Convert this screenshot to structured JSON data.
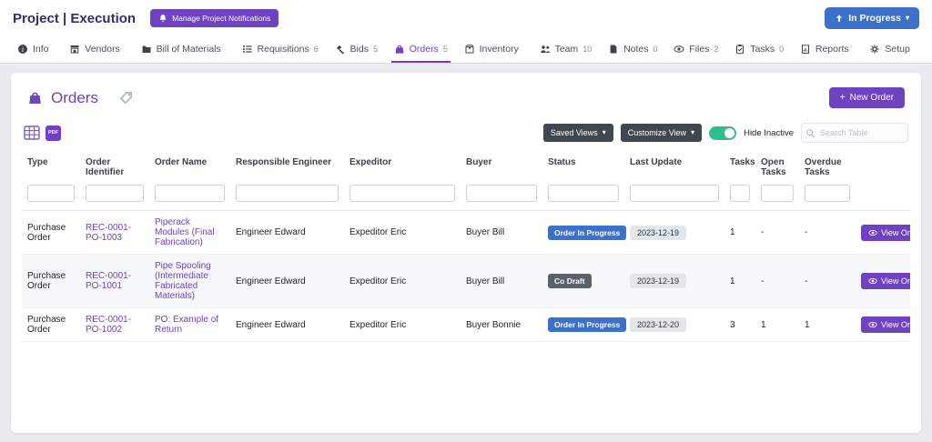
{
  "colors": {
    "accent_purple": "#6f42c1",
    "primary_blue": "#3b71ca",
    "dark_button": "#40474e",
    "toggle_green": "#2dbf8d",
    "badge_dark": "#59616a",
    "title_navy": "#322e66"
  },
  "icons": {
    "caret_down": "▾",
    "plus": "+"
  },
  "header": {
    "title": "Project | Execution",
    "manage_notifications_label": "Manage Project Notifications",
    "status_label": "In Progress"
  },
  "tabs": [
    {
      "label": "Info",
      "count": ""
    },
    {
      "label": "Vendors",
      "count": ""
    },
    {
      "label": "Bill of Materials",
      "count": ""
    },
    {
      "label": "Requisitions",
      "count": "6"
    },
    {
      "label": "Bids",
      "count": "5"
    },
    {
      "label": "Orders",
      "count": "5"
    },
    {
      "label": "Inventory",
      "count": ""
    },
    {
      "label": "Team",
      "count": "10"
    },
    {
      "label": "Notes",
      "count": "0"
    },
    {
      "label": "Files",
      "count": "2"
    },
    {
      "label": "Tasks",
      "count": "0"
    },
    {
      "label": "Reports",
      "count": ""
    },
    {
      "label": "Setup",
      "count": ""
    }
  ],
  "page": {
    "title": "Orders",
    "new_order_label": "New Order"
  },
  "toolbar": {
    "saved_views_label": "Saved Views",
    "customize_view_label": "Customize View",
    "hide_inactive_label": "Hide Inactive",
    "search_placeholder": "Search Table",
    "pdf_label": "PDF"
  },
  "table": {
    "columns": [
      "Type",
      "Order Identifier",
      "Order Name",
      "Responsible Engineer",
      "Expeditor",
      "Buyer",
      "Status",
      "Last Update",
      "Tasks",
      "Open Tasks",
      "Overdue Tasks"
    ],
    "rows": [
      {
        "type": "Purchase Order",
        "identifier": "REC-0001-PO-1003",
        "name": "Piperack Modules (Final Fabrication)",
        "engineer": "Engineer Edward",
        "expeditor": "Expeditor Eric",
        "buyer": "Buyer Bill",
        "status": "Order In Progress",
        "status_variant": "blue",
        "last_update": "2023-12-19",
        "tasks": "1",
        "open_tasks": "-",
        "overdue_tasks": "-",
        "action_label": "View Or"
      },
      {
        "type": "Purchase Order",
        "identifier": "REC-0001-PO-1001",
        "name": "Pipe Spooling (Intermediate Fabricated Materials)",
        "engineer": "Engineer Edward",
        "expeditor": "Expeditor Eric",
        "buyer": "Buyer Bill",
        "status": "Co Draft",
        "status_variant": "dark",
        "last_update": "2023-12-19",
        "tasks": "1",
        "open_tasks": "-",
        "overdue_tasks": "-",
        "action_label": "View Or"
      },
      {
        "type": "Purchase Order",
        "identifier": "REC-0001-PO-1002",
        "name": "PO: Example of Return",
        "engineer": "Engineer Edward",
        "expeditor": "Expeditor Eric",
        "buyer": "Buyer Bonnie",
        "status": "Order In Progress",
        "status_variant": "blue",
        "last_update": "2023-12-20",
        "tasks": "3",
        "open_tasks": "1",
        "overdue_tasks": "1",
        "action_label": "View Or"
      }
    ]
  }
}
